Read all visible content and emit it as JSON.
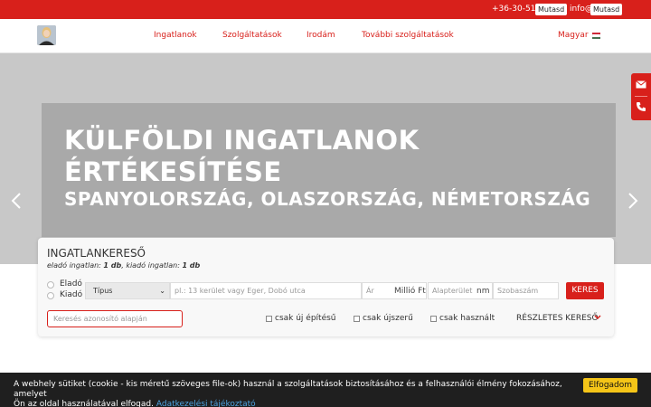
{
  "topbar": {
    "phone": "+36-30-514",
    "phone_reveal": "Mutasd",
    "email": "info@",
    "email_reveal": "Mutasd"
  },
  "nav": {
    "items": [
      {
        "label": "Ingatlanok"
      },
      {
        "label": "Szolgáltatások"
      },
      {
        "label": "Irodám"
      },
      {
        "label": "További szolgáltatások"
      }
    ],
    "language": "Magyar",
    "flag_colors": [
      "#ce2939",
      "#ffffff",
      "#477050"
    ]
  },
  "hero": {
    "title": "KÜLFÖLDI INGATLANOK ÉRTÉKESÍTÉSE",
    "subtitle": "SPANYOLORSZÁG, OLASZORSZÁG, NÉMETORSZÁG",
    "prev_icon": "chevron-left-icon",
    "next_icon": "chevron-right-icon"
  },
  "side_tabs": {
    "mail_icon": "envelope-icon",
    "phone_icon": "phone-icon"
  },
  "search": {
    "title": "INGATLANKERESŐ",
    "counts_prefix": "eladó ingatlan:",
    "sale_count": "1 db",
    "counts_middle": ", kiadó ingatlan:",
    "rent_count": "1 db",
    "radio_sale": "Eladó",
    "radio_rent": "Kiadó",
    "type_select": "Típus",
    "location_placeholder": "pl.: 13 kerület vagy Eger, Dobó utca",
    "price_placeholder": "Ár",
    "price_unit": "Millió Ft",
    "area_placeholder": "Alapterület",
    "area_unit": "nm",
    "rooms_placeholder": "Szobaszám",
    "search_button": "KERES",
    "id_placeholder": "Keresés azonosító alapján",
    "check_new_build": "csak új építésű",
    "check_like_new": "csak újszerű",
    "check_used": "csak használt",
    "detailed_search": "RÉSZLETES KERESŐ"
  },
  "cookie": {
    "text_line1": "A webhely sütiket (cookie - kis méretű szöveges file-ok) használ a szolgáltatások biztosításához és a felhasználói élmény fokozásához, amelyet",
    "text_line2": "Ön az oldal használatával elfogad.",
    "link": "Adatkezelési tájékoztató",
    "accept": "Elfogadom"
  },
  "colors": {
    "brand_red": "#d8201b",
    "cookie_bg": "#1f1f1f",
    "accept_yellow": "#f5c518"
  }
}
